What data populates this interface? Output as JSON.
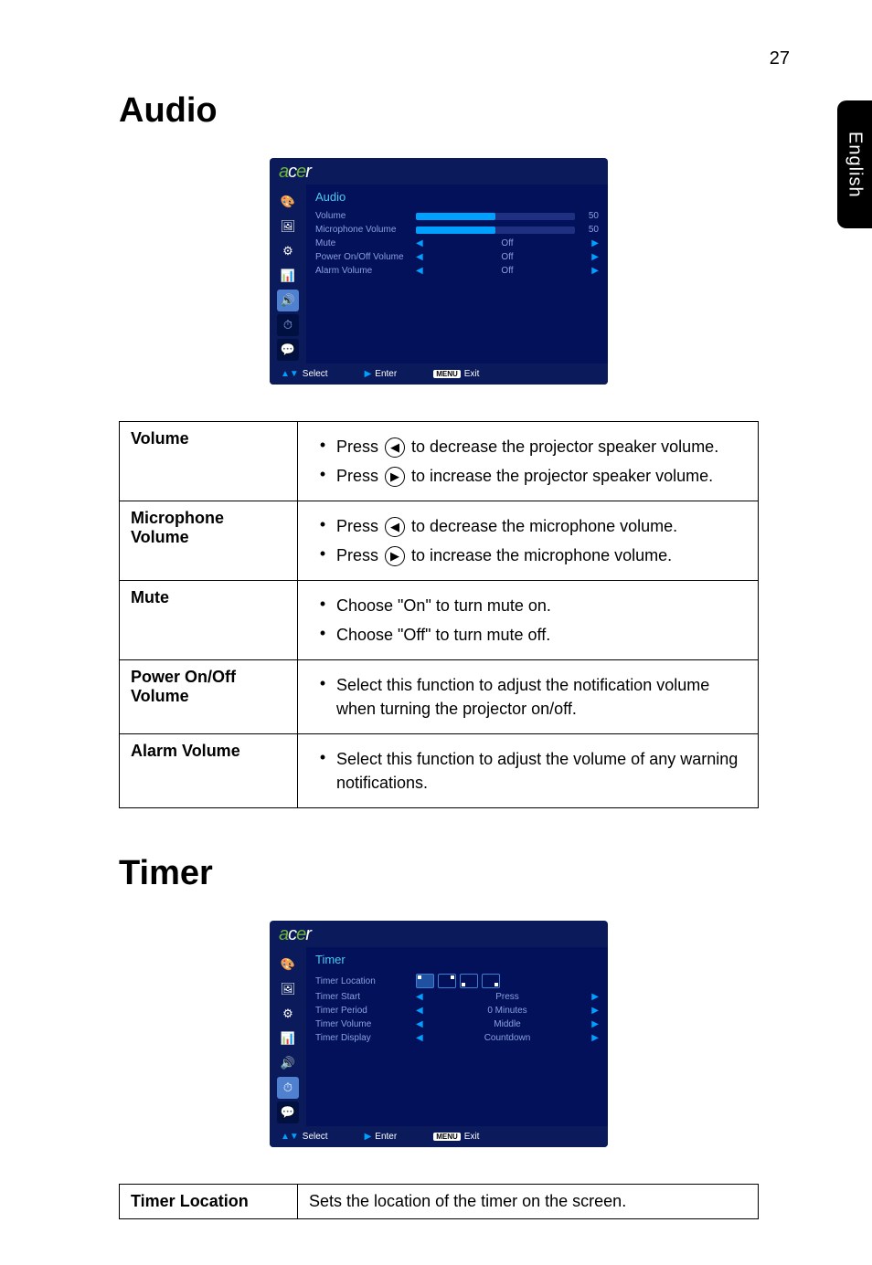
{
  "page_number": "27",
  "side_tab": "English",
  "sections": {
    "audio": {
      "heading": "Audio",
      "osd": {
        "title": "Audio",
        "rows": {
          "volume": {
            "label": "Volume",
            "value": "50"
          },
          "mic_volume": {
            "label": "Microphone Volume",
            "value": "50"
          },
          "mute": {
            "label": "Mute",
            "value": "Off"
          },
          "power": {
            "label": "Power On/Off Volume",
            "value": "Off"
          },
          "alarm": {
            "label": "Alarm Volume",
            "value": "Off"
          }
        }
      },
      "table": {
        "volume": {
          "name": "Volume",
          "line1_a": "Press ",
          "line1_b": " to decrease the projector speaker volume.",
          "line2_a": "Press ",
          "line2_b": " to increase the projector speaker volume."
        },
        "mic": {
          "name": "Microphone Volume",
          "line1_a": "Press ",
          "line1_b": " to decrease the microphone volume.",
          "line2_a": "Press ",
          "line2_b": " to increase the microphone volume."
        },
        "mute": {
          "name": "Mute",
          "line1": "Choose \"On\" to turn mute on.",
          "line2": "Choose \"Off\" to turn mute off."
        },
        "power": {
          "name": "Power On/Off Volume",
          "line1": "Select this function to adjust the notification volume when turning the projector on/off."
        },
        "alarm": {
          "name": "Alarm Volume",
          "line1": "Select this function to adjust the volume of any warning notifications."
        }
      }
    },
    "timer": {
      "heading": "Timer",
      "osd": {
        "title": "Timer",
        "rows": {
          "location": {
            "label": "Timer Location"
          },
          "start": {
            "label": "Timer Start",
            "value": "Press"
          },
          "period": {
            "label": "Timer Period",
            "value": "0 Minutes"
          },
          "volume": {
            "label": "Timer Volume",
            "value": "Middle"
          },
          "display": {
            "label": "Timer Display",
            "value": "Countdown"
          }
        }
      },
      "table": {
        "location": {
          "name": "Timer Location",
          "desc": "Sets the location of the timer on the screen."
        }
      }
    }
  },
  "osd_footer": {
    "select": "Select",
    "enter": "Enter",
    "exit": "Exit",
    "menu_badge": "MENU"
  }
}
